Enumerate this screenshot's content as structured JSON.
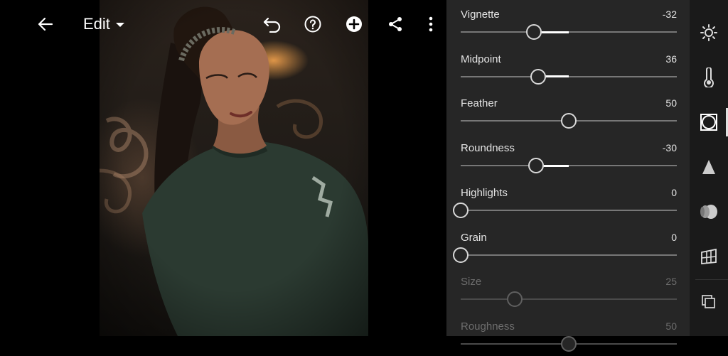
{
  "header": {
    "title": "Edit",
    "icons": [
      "back-arrow-icon",
      "undo-icon",
      "help-icon",
      "add-icon",
      "share-icon",
      "more-vertical-icon"
    ]
  },
  "sliders": [
    {
      "label": "Vignette",
      "value": "-32",
      "pos": 0.34,
      "center": 0.5,
      "enabled": true
    },
    {
      "label": "Midpoint",
      "value": "36",
      "pos": 0.36,
      "center": 0.5,
      "enabled": true
    },
    {
      "label": "Feather",
      "value": "50",
      "pos": 0.5,
      "center": 0.5,
      "enabled": true
    },
    {
      "label": "Roundness",
      "value": "-30",
      "pos": 0.35,
      "center": 0.5,
      "enabled": true
    },
    {
      "label": "Highlights",
      "value": "0",
      "pos": 0.0,
      "center": 0.0,
      "enabled": true
    },
    {
      "label": "Grain",
      "value": "0",
      "pos": 0.0,
      "center": 0.0,
      "enabled": true
    },
    {
      "label": "Size",
      "value": "25",
      "pos": 0.25,
      "center": 0.25,
      "enabled": false
    },
    {
      "label": "Roughness",
      "value": "50",
      "pos": 0.5,
      "center": 0.5,
      "enabled": false
    }
  ],
  "tools": [
    "light-icon",
    "color-temperature-icon",
    "effects-vignette-icon",
    "detail-sharpen-icon",
    "optics-lens-icon",
    "geometry-icon",
    "versions-icon"
  ],
  "colors": {
    "panel": "#262626",
    "strip": "#1a1a1a",
    "accent": "#ffffff"
  }
}
